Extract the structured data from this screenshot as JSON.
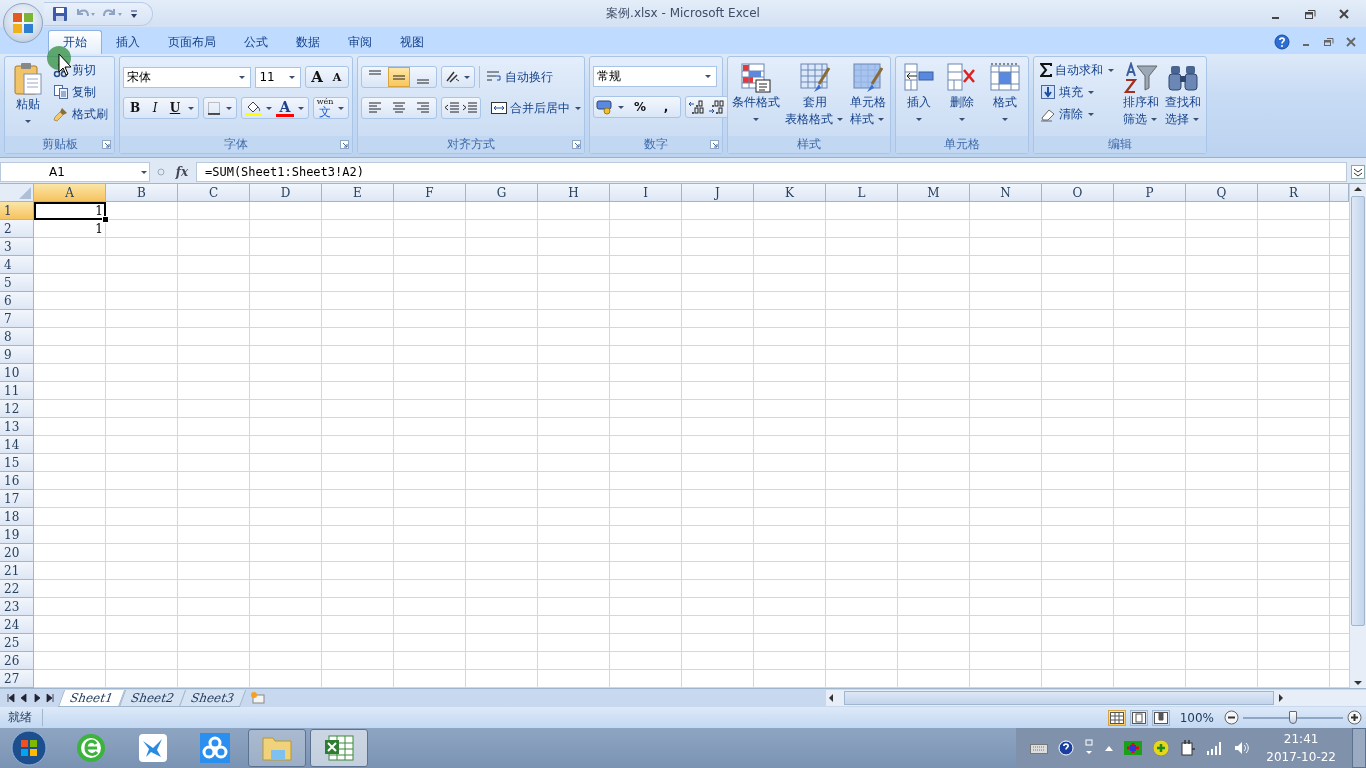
{
  "window": {
    "title": "案例.xlsx - Microsoft Excel"
  },
  "tabs": [
    {
      "label": "开始",
      "selected": true
    },
    {
      "label": "插入",
      "selected": false
    },
    {
      "label": "页面布局",
      "selected": false
    },
    {
      "label": "公式",
      "selected": false
    },
    {
      "label": "数据",
      "selected": false
    },
    {
      "label": "审阅",
      "selected": false
    },
    {
      "label": "视图",
      "selected": false
    }
  ],
  "ribbon_groups": [
    {
      "kind": "clipboard",
      "label": "剪贴板",
      "paste": "粘贴",
      "actions": [
        {
          "label": "剪切"
        },
        {
          "label": "复制"
        },
        {
          "label": "格式刷"
        }
      ]
    },
    {
      "kind": "font",
      "label": "字体",
      "font_name": "宋体",
      "font_size": "11",
      "size_buttons": [
        "A",
        "A"
      ],
      "style_buttons": [
        "B",
        "I",
        "U"
      ],
      "font_color_letter": "A",
      "phonetic": {
        "reading": "wén",
        "character": "文"
      }
    },
    {
      "kind": "alignment",
      "label": "对齐方式",
      "vertical": [
        {
          "selected": false
        },
        {
          "selected": true
        },
        {
          "selected": false
        }
      ],
      "horizontal": [
        {
          "selected": false
        },
        {
          "selected": false
        },
        {
          "selected": false
        }
      ],
      "wrap": "自动换行",
      "merge": "合并后居中"
    },
    {
      "kind": "number",
      "label": "数字",
      "format": "常规",
      "symbol_buttons": [
        "%",
        ","
      ]
    },
    {
      "kind": "styles",
      "label": "样式",
      "buttons": [
        {
          "lines": [
            "条件格式"
          ]
        },
        {
          "lines": [
            "套用",
            "表格格式"
          ]
        },
        {
          "lines": [
            "单元格",
            "样式"
          ]
        }
      ]
    },
    {
      "kind": "cells",
      "label": "单元格",
      "buttons": [
        {
          "lines": [
            "插入"
          ]
        },
        {
          "lines": [
            "删除"
          ]
        },
        {
          "lines": [
            "格式"
          ]
        }
      ]
    },
    {
      "kind": "editing",
      "label": "编辑",
      "actions": [
        {
          "label": "自动求和"
        },
        {
          "label": "填充"
        },
        {
          "label": "清除"
        }
      ],
      "buttons": [
        {
          "lines": [
            "排序和",
            "筛选"
          ]
        },
        {
          "lines": [
            "查找和",
            "选择"
          ]
        }
      ]
    }
  ],
  "formula_bar": {
    "name_box": "A1",
    "function_label": "fx",
    "formula": "=SUM(Sheet1:Sheet3!A2)"
  },
  "grid": {
    "columns": [
      {
        "label": "A",
        "selected": true
      },
      {
        "label": "B",
        "selected": false
      },
      {
        "label": "C",
        "selected": false
      },
      {
        "label": "D",
        "selected": false
      },
      {
        "label": "E",
        "selected": false
      },
      {
        "label": "F",
        "selected": false
      },
      {
        "label": "G",
        "selected": false
      },
      {
        "label": "H",
        "selected": false
      },
      {
        "label": "I",
        "selected": false
      },
      {
        "label": "J",
        "selected": false
      },
      {
        "label": "K",
        "selected": false
      },
      {
        "label": "L",
        "selected": false
      },
      {
        "label": "M",
        "selected": false
      },
      {
        "label": "N",
        "selected": false
      },
      {
        "label": "O",
        "selected": false
      },
      {
        "label": "P",
        "selected": false
      },
      {
        "label": "Q",
        "selected": false
      },
      {
        "label": "R",
        "selected": false
      }
    ],
    "rows": [
      {
        "label": "1",
        "selected": true,
        "cells": [
          "1"
        ]
      },
      {
        "label": "2",
        "selected": false,
        "cells": [
          "1"
        ]
      },
      {
        "label": "3",
        "selected": false
      },
      {
        "label": "4",
        "selected": false
      },
      {
        "label": "5",
        "selected": false
      },
      {
        "label": "6",
        "selected": false
      },
      {
        "label": "7",
        "selected": false
      },
      {
        "label": "8",
        "selected": false
      },
      {
        "label": "9",
        "selected": false
      },
      {
        "label": "10",
        "selected": false
      },
      {
        "label": "11",
        "selected": false
      },
      {
        "label": "12",
        "selected": false
      },
      {
        "label": "13",
        "selected": false
      },
      {
        "label": "14",
        "selected": false
      },
      {
        "label": "15",
        "selected": false
      },
      {
        "label": "16",
        "selected": false
      },
      {
        "label": "17",
        "selected": false
      },
      {
        "label": "18",
        "selected": false
      },
      {
        "label": "19",
        "selected": false
      },
      {
        "label": "20",
        "selected": false
      },
      {
        "label": "21",
        "selected": false
      },
      {
        "label": "22",
        "selected": false
      },
      {
        "label": "23",
        "selected": false
      },
      {
        "label": "24",
        "selected": false
      },
      {
        "label": "25",
        "selected": false
      },
      {
        "label": "26",
        "selected": false
      },
      {
        "label": "27",
        "selected": false
      }
    ]
  },
  "sheet_tabs": [
    {
      "label": "Sheet1",
      "selected": true
    },
    {
      "label": "Sheet2",
      "selected": false
    },
    {
      "label": "Sheet3",
      "selected": false
    }
  ],
  "status_bar": {
    "text": "就绪",
    "views": [
      {
        "selected": true
      },
      {
        "selected": false
      },
      {
        "selected": false
      }
    ],
    "zoom": "100%",
    "zoom_slider": {
      "level": 0.5
    }
  },
  "taskbar": {
    "apps": [
      {
        "kind": "browser",
        "open": false,
        "selected": false
      },
      {
        "kind": "bird",
        "open": false,
        "selected": false
      },
      {
        "kind": "cloud",
        "open": false,
        "selected": false
      },
      {
        "kind": "folder",
        "open": true,
        "selected": false
      },
      {
        "kind": "spreadsheet",
        "open": true,
        "selected": true
      }
    ],
    "clock": {
      "time": "21:41",
      "date": "2017-10-22"
    }
  }
}
